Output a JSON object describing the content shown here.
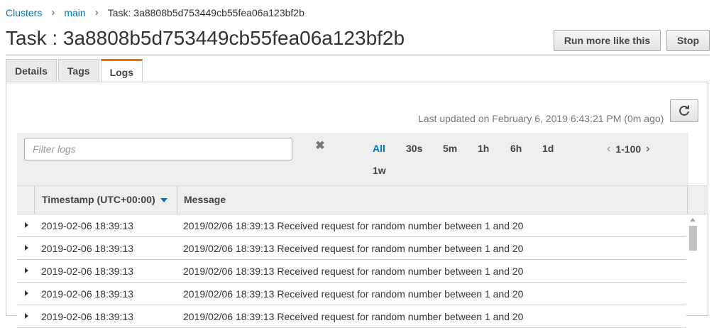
{
  "breadcrumb": {
    "items": [
      "Clusters",
      "main"
    ],
    "current": "Task: 3a8808b5d753449cb55fea06a123bf2b"
  },
  "page": {
    "title": "Task : 3a8808b5d753449cb55fea06a123bf2b",
    "run_more_label": "Run more like this",
    "stop_label": "Stop"
  },
  "tabs": [
    {
      "label": "Details",
      "active": false
    },
    {
      "label": "Tags",
      "active": false
    },
    {
      "label": "Logs",
      "active": true
    }
  ],
  "logs": {
    "last_updated": "Last updated on February 6, 2019 6:43:21 PM (0m ago)",
    "filter_placeholder": "Filter logs",
    "time_ranges": [
      "All",
      "30s",
      "5m",
      "1h",
      "6h",
      "1d",
      "1w"
    ],
    "active_range": "All",
    "pagination": "1-100",
    "columns": [
      "Timestamp (UTC+00:00)",
      "Message"
    ],
    "rows": [
      {
        "timestamp": "2019-02-06 18:39:13",
        "message": "2019/02/06 18:39:13 Received request for random number between 1 and 20"
      },
      {
        "timestamp": "2019-02-06 18:39:13",
        "message": "2019/02/06 18:39:13 Received request for random number between 1 and 20"
      },
      {
        "timestamp": "2019-02-06 18:39:13",
        "message": "2019/02/06 18:39:13 Received request for random number between 1 and 20"
      },
      {
        "timestamp": "2019-02-06 18:39:13",
        "message": "2019/02/06 18:39:13 Received request for random number between 1 and 20"
      },
      {
        "timestamp": "2019-02-06 18:39:13",
        "message": "2019/02/06 18:39:13 Received request for random number between 1 and 20"
      }
    ]
  },
  "colors": {
    "link": "#0073bb",
    "active_tab_accent": "#ec7211"
  },
  "icons": {
    "refresh": "refresh-icon",
    "clear": "clear-filter-icon",
    "sort": "sort-descending-icon",
    "expand": "expand-row-icon"
  }
}
